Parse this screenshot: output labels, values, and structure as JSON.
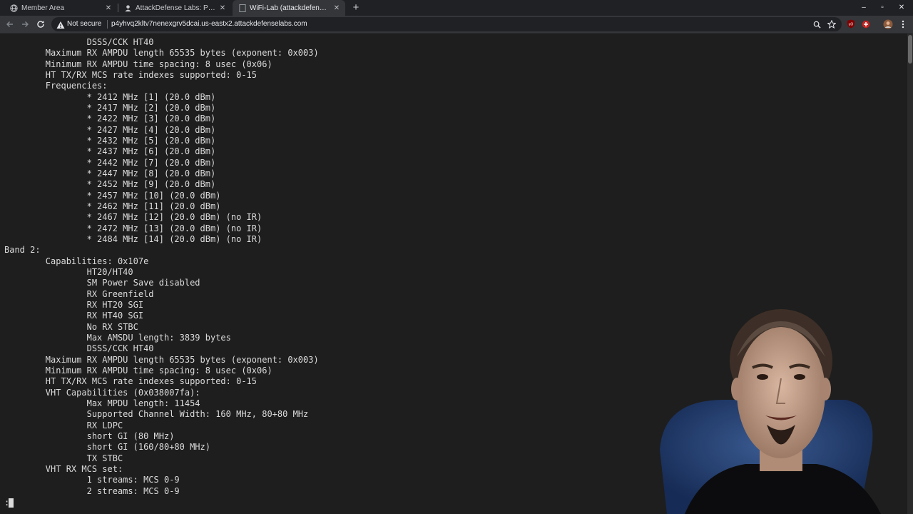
{
  "tabs": [
    {
      "title": "Member Area",
      "icon": "globe-icon"
    },
    {
      "title": "AttackDefense Labs: Pente",
      "icon": "user-icon"
    },
    {
      "title": "WiFi-Lab (attackdefense.c",
      "icon": "blank-page-icon"
    }
  ],
  "new_tab_label": "+",
  "window_controls": {
    "minimize": "–",
    "maximize": "▫",
    "close": "✕"
  },
  "toolbar": {
    "security_text": "Not secure",
    "url": "p4yhvq2kltv7nenexgrv5dcai.us-eastx2.attackdefenselabs.com"
  },
  "terminal": {
    "lines": [
      "                DSSS/CCK HT40",
      "        Maximum RX AMPDU length 65535 bytes (exponent: 0x003)",
      "        Minimum RX AMPDU time spacing: 8 usec (0x06)",
      "        HT TX/RX MCS rate indexes supported: 0-15",
      "        Frequencies:",
      "                * 2412 MHz [1] (20.0 dBm)",
      "                * 2417 MHz [2] (20.0 dBm)",
      "                * 2422 MHz [3] (20.0 dBm)",
      "                * 2427 MHz [4] (20.0 dBm)",
      "                * 2432 MHz [5] (20.0 dBm)",
      "                * 2437 MHz [6] (20.0 dBm)",
      "                * 2442 MHz [7] (20.0 dBm)",
      "                * 2447 MHz [8] (20.0 dBm)",
      "                * 2452 MHz [9] (20.0 dBm)",
      "                * 2457 MHz [10] (20.0 dBm)",
      "                * 2462 MHz [11] (20.0 dBm)",
      "                * 2467 MHz [12] (20.0 dBm) (no IR)",
      "                * 2472 MHz [13] (20.0 dBm) (no IR)",
      "                * 2484 MHz [14] (20.0 dBm) (no IR)",
      "Band 2:",
      "        Capabilities: 0x107e",
      "                HT20/HT40",
      "                SM Power Save disabled",
      "                RX Greenfield",
      "                RX HT20 SGI",
      "                RX HT40 SGI",
      "                No RX STBC",
      "                Max AMSDU length: 3839 bytes",
      "                DSSS/CCK HT40",
      "        Maximum RX AMPDU length 65535 bytes (exponent: 0x003)",
      "        Minimum RX AMPDU time spacing: 8 usec (0x06)",
      "        HT TX/RX MCS rate indexes supported: 0-15",
      "        VHT Capabilities (0x038007fa):",
      "                Max MPDU length: 11454",
      "                Supported Channel Width: 160 MHz, 80+80 MHz",
      "                RX LDPC",
      "                short GI (80 MHz)",
      "                short GI (160/80+80 MHz)",
      "                TX STBC",
      "        VHT RX MCS set:",
      "                1 streams: MCS 0-9",
      "                2 streams: MCS 0-9"
    ],
    "prompt": ":"
  },
  "colors": {
    "tabstrip_bg": "#202124",
    "toolbar_bg": "#35363a",
    "terminal_bg": "#1e1e1e",
    "terminal_fg": "#dcdcdc"
  }
}
